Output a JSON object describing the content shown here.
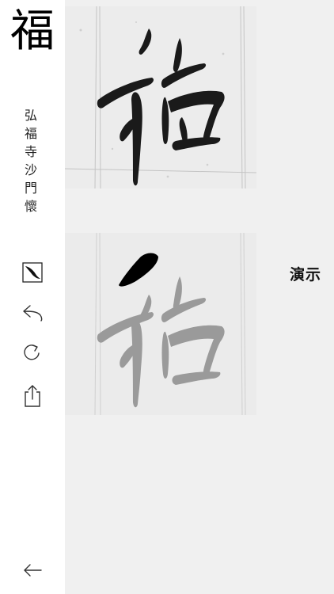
{
  "sidebar": {
    "character": "福",
    "author": "弘福寺沙門懷",
    "tools": [
      {
        "icon": "brush-icon"
      },
      {
        "icon": "undo-icon"
      },
      {
        "icon": "redo-icon"
      },
      {
        "icon": "share-icon"
      }
    ],
    "back_icon": "back-arrow-icon"
  },
  "main": {
    "demo_label": "演示"
  }
}
